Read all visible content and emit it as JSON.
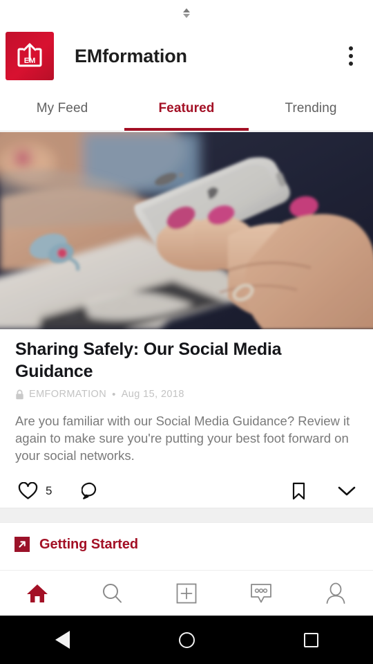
{
  "theme": {
    "accent_red": "#a31025",
    "logo_red": "#d81130",
    "text_dark": "#15161a",
    "text_muted": "#7a7a7a",
    "divider": "#f0f0f0"
  },
  "scroll_indicator": {
    "up_icon": "triangle-up-icon",
    "down_icon": "triangle-down-icon"
  },
  "header": {
    "logo_text": "EM",
    "logo_icon": "upload-box-icon",
    "title": "EMformation",
    "overflow_icon": "more-vertical-icon"
  },
  "tabs": [
    {
      "label": "My Feed",
      "active": false
    },
    {
      "label": "Featured",
      "active": true
    },
    {
      "label": "Trending",
      "active": false
    }
  ],
  "article": {
    "hero_image_alt": "hands holding a smartphone over a laptop keyboard",
    "title": "Sharing Safely: Our Social Media Guidance",
    "lock_icon": "lock-icon",
    "source": "EMFORMATION",
    "separator": "•",
    "date": "Aug 15, 2018",
    "body": "Are you familiar with our Social Media Guidance? Review it again to make sure you're putting your best foot forward on your social networks.",
    "actions": {
      "like_icon": "heart-icon",
      "like_count": "5",
      "comment_icon": "comment-bubble-icon",
      "bookmark_icon": "bookmark-icon",
      "expand_icon": "chevron-down-icon"
    }
  },
  "section_link": {
    "icon": "external-link-icon",
    "label": "Getting Started"
  },
  "bottom_nav": [
    {
      "name": "home",
      "icon": "home-icon",
      "active": true
    },
    {
      "name": "search",
      "icon": "search-icon",
      "active": false
    },
    {
      "name": "create",
      "icon": "plus-box-icon",
      "active": false
    },
    {
      "name": "messages",
      "icon": "message-dots-icon",
      "active": false
    },
    {
      "name": "profile",
      "icon": "person-icon",
      "active": false
    }
  ],
  "system_bar": {
    "back_icon": "triangle-back-icon",
    "home_icon": "circle-home-icon",
    "recents_icon": "square-recents-icon"
  }
}
